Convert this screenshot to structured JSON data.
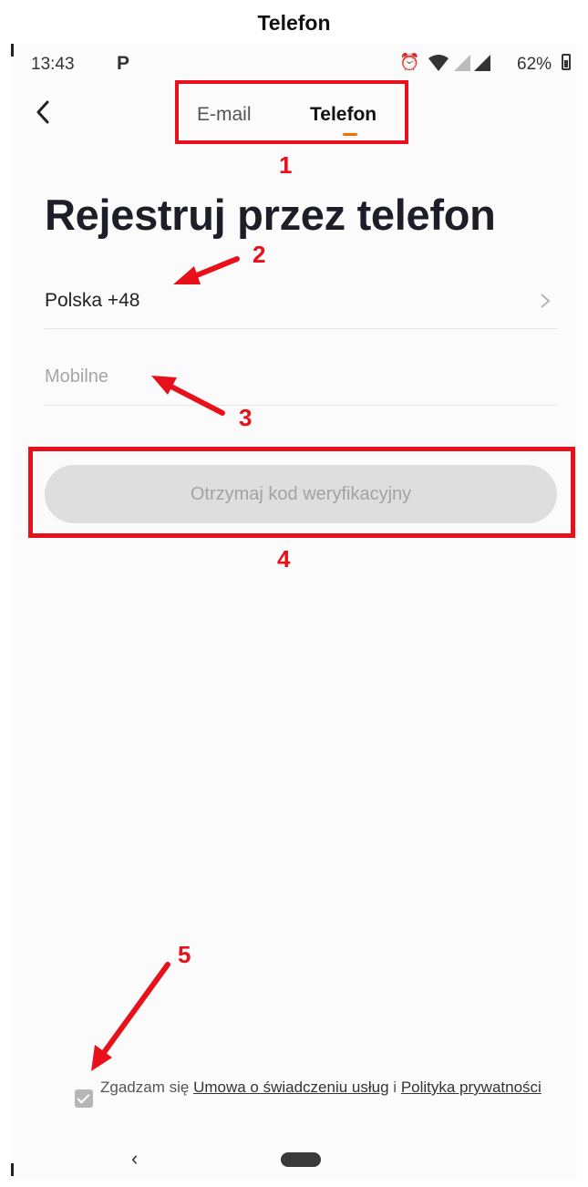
{
  "doc_title": "Telefon",
  "status_bar": {
    "time": "13:43",
    "app_icon": "P",
    "battery": "62%",
    "icons": [
      "alarm-icon",
      "wifi-icon",
      "signal-icon",
      "signal-icon",
      "battery-icon"
    ]
  },
  "header": {
    "tabs": [
      {
        "label": "E-mail",
        "active": false
      },
      {
        "label": "Telefon",
        "active": true
      }
    ],
    "accent_color": "#ff6a00"
  },
  "annotations": [
    "1",
    "2",
    "3",
    "4",
    "5"
  ],
  "annotation_color": "#e8101a",
  "main": {
    "title": "Rejestruj przez telefon",
    "country": "Polska +48",
    "mobile": {
      "placeholder": "Mobilne",
      "value": ""
    },
    "verify_button": "Otrzymaj kod weryfikacyjny"
  },
  "consent": {
    "checked": true,
    "prefix": "Zgadzam się",
    "link1": "Umowa o świadczeniu usług",
    "conj": "i",
    "link2": "Polityka prywatności"
  }
}
